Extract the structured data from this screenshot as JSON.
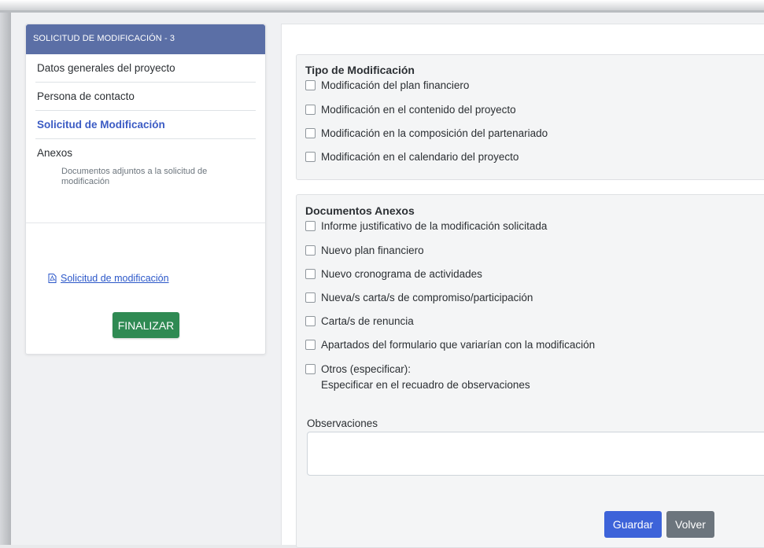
{
  "sidebar": {
    "header": "SOLICITUD DE MODIFICACIÓN - 3",
    "items": [
      {
        "label": "Datos generales del proyecto"
      },
      {
        "label": "Persona de contacto"
      },
      {
        "label": "Solicitud de Modificación"
      },
      {
        "label": "Anexos",
        "sub": "Documentos adjuntos a la solicitud de modificación"
      }
    ],
    "doc_link": "Solicitud de modificación",
    "finalize_label": "FINALIZAR"
  },
  "tipo": {
    "title": "Tipo de Modificación",
    "options": [
      "Modificación del plan financiero",
      "Modificación en el contenido del proyecto",
      "Modificación en la composición del partenariado",
      "Modificación en el calendario del proyecto"
    ]
  },
  "docs": {
    "title": "Documentos Anexos",
    "options": [
      "Informe justificativo de la modificación solicitada",
      "Nuevo plan financiero",
      "Nuevo cronograma de actividades",
      "Nueva/s carta/s de compromiso/participación",
      "Carta/s de renuncia",
      "Apartados del formulario que variarían con la modificación",
      "Otros (especificar):"
    ],
    "otros_sub": "Especificar en el recuadro de observaciones",
    "observaciones_label": "Observaciones",
    "observaciones_value": "",
    "save_label": "Guardar",
    "back_label": "Volver"
  },
  "colors": {
    "header_bg": "#5b6fa6",
    "active_link": "#3b5bc4",
    "finalize_bg": "#2f8a53",
    "save_bg": "#3d63d9",
    "back_bg": "#6c757d"
  }
}
